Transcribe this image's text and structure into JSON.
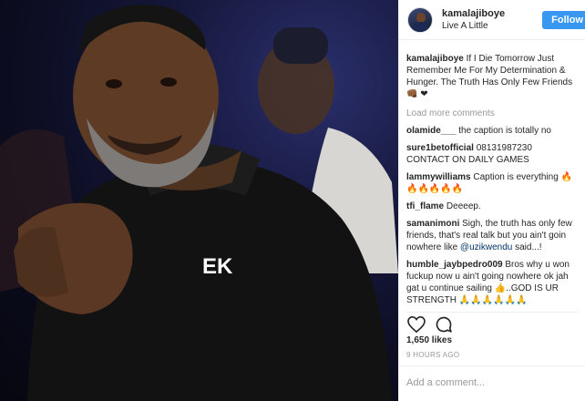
{
  "post": {
    "username": "kamalajiboye",
    "location": "Live A Little",
    "follow_label": "Follow",
    "caption_user": "kamalajiboye",
    "caption_text": "If I Die Tomorrow Just Remember Me For My Determination & Hunger. The Truth Has Only Few Friends👊🏾 ❤",
    "load_more": "Load more comments",
    "likes": "1,650 likes",
    "time": "9 HOURS AGO",
    "add_comment_placeholder": "Add a comment..."
  },
  "comments": [
    {
      "user": "olamide___",
      "text": "the caption is totally no"
    },
    {
      "user": "sure1betofficial",
      "text": "08131987230 CONTACT ON DAILY GAMES"
    },
    {
      "user": "lammywilliams",
      "text": "Caption is everything 🔥🔥🔥🔥🔥🔥"
    },
    {
      "user": "tfi_flame",
      "text": "Deeeep."
    },
    {
      "user": "samanimoni",
      "text_before": "Sigh, the truth has only few friends, that's real talk but you ain't goin nowhere like ",
      "mention": "@uzikwendu",
      "text_after": " said...!"
    },
    {
      "user": "humble_jaybpedro009",
      "text": "Bros why u won fuckup now u ain't going nowhere ok jah gat u continue sailing 👍..GOD IS UR STRENGTH 🙏🙏🙏🙏🙏🙏"
    }
  ],
  "photo": {
    "hoodie_logo": "EK"
  }
}
